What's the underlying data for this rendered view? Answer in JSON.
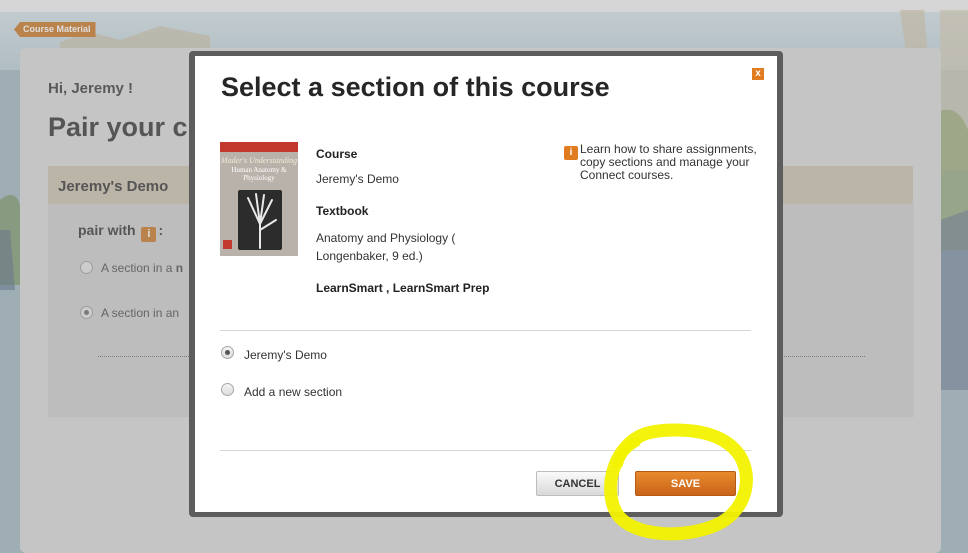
{
  "app": {
    "course_tag": "Course Material"
  },
  "page": {
    "greeting": "Hi, Jeremy !",
    "title": "Pair your c",
    "course_bar": "Jeremy's Demo",
    "pair_with_label": "pair with",
    "pair_with_colon": ":",
    "info_glyph": "i",
    "options": [
      {
        "label": "A section in a",
        "bold_suffix": "n",
        "selected": false
      },
      {
        "label": "A section in an",
        "selected": true
      }
    ]
  },
  "modal": {
    "title": "Select a section of this course",
    "close_label": "x",
    "book_cover": {
      "line1": "Mader's Understanding",
      "line2": "Human Anatomy & Physiology"
    },
    "course_label": "Course",
    "course_value": "Jeremy's Demo",
    "textbook_label": "Textbook",
    "textbook_value": "Anatomy and Physiology ( Longenbaker, 9 ed.)",
    "products": "LearnSmart , LearnSmart Prep",
    "help_glyph": "i",
    "help_text": "Learn how to share assignments, copy sections and manage your Connect courses.",
    "sections": [
      {
        "label": "Jeremy's Demo",
        "selected": true
      },
      {
        "label": "Add a new section",
        "selected": false
      }
    ],
    "cancel_label": "CANCEL",
    "save_label": "SAVE"
  },
  "colors": {
    "accent": "#e07b1f",
    "save_button": "#d46f1f",
    "highlight": "#f2f200",
    "course_bar": "#c9c0ad"
  }
}
